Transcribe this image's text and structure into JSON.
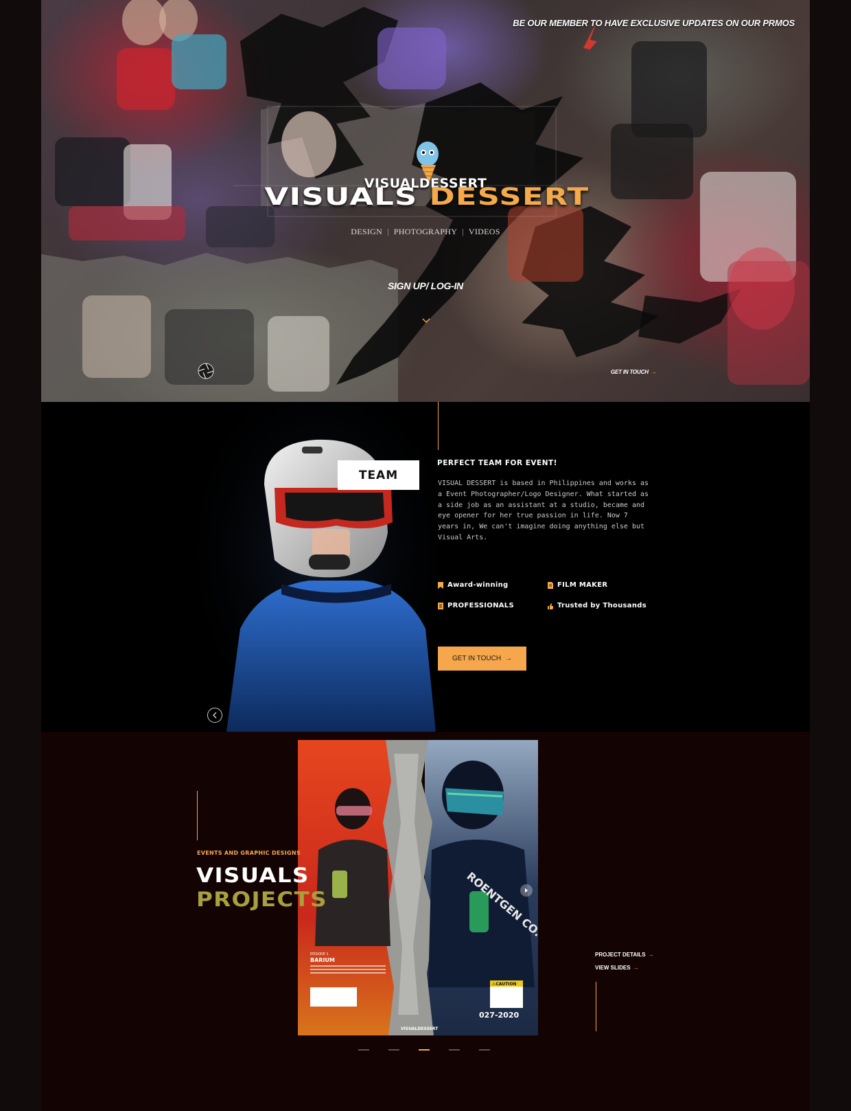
{
  "hero": {
    "promo": "BE OUR MEMBER TO HAVE EXCLUSIVE  UPDATES ON OUR PRMOS",
    "logo_small": "VISUALDESSERT",
    "logo_word1": "VISUALS",
    "logo_word2": "DESSERT",
    "nav": [
      "DESIGN",
      "PHOTOGRAPHY",
      "VIDEOS"
    ],
    "signup": "SIGN UP/ LOG-IN",
    "get_in_touch": "GET IN TOUCH"
  },
  "team": {
    "badge": "TEAM",
    "title": "PERFECT TEAM FOR EVENT!",
    "description": "VISUAL DESSERT is based in Philippines and works as a Event Photographer/Logo Designer. What started as a side job as an assistant at a studio, became and eye opener for her true passion in life. Now 7 years in, We can't imagine doing anything else but Visual Arts.",
    "features": [
      "Award-winning",
      "FILM MAKER",
      "PROFESSIONALS",
      "Trusted by Thousands"
    ],
    "button": "GET IN TOUCH"
  },
  "projects": {
    "kicker": "EVENTS AND GRAPHIC DESIGNS",
    "title_line1": "VISUALS",
    "title_line2": "PROJECTS",
    "project_details": "PROJECT DETAILS",
    "view_slides": "VIEW SLIDES",
    "slides": 5,
    "active_slide": 3
  },
  "poster": {
    "episode": "EPISODE 1",
    "heading": "BARIUM",
    "caution": "⚠CAUTION",
    "brand": "ROENTGEN CO.",
    "year": "027-2020",
    "footer": "VISUALDESSERT"
  },
  "colors": {
    "accent": "#f4a94a",
    "olive": "#a7a03c",
    "maroon": "#140303"
  },
  "icons": [
    "aperture-icon",
    "chevron-down-icon",
    "arrow-right-icon",
    "chevron-left-icon",
    "chevron-right-icon",
    "bookmark-icon",
    "document-icon",
    "thumbs-up-icon"
  ]
}
